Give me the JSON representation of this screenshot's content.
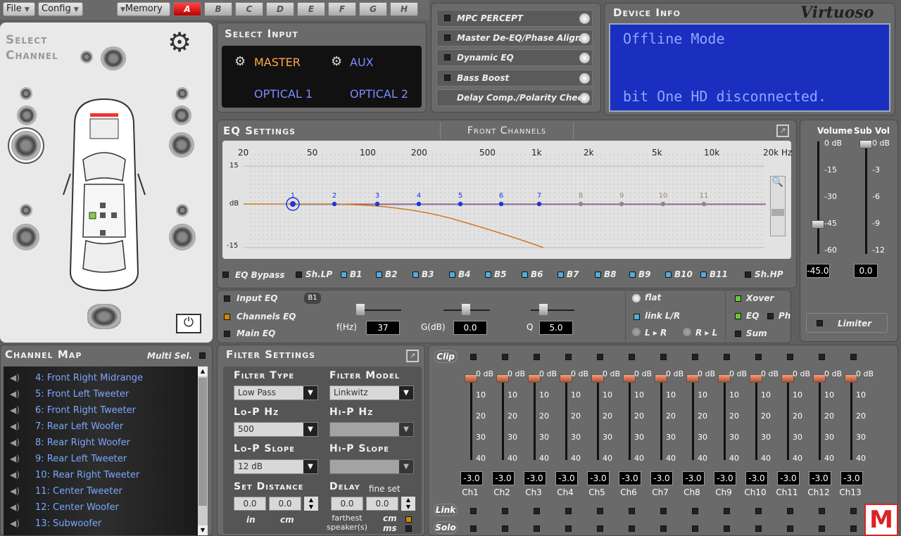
{
  "menu": {
    "file": "File",
    "config": "Config",
    "memory": "Memory"
  },
  "memory_tabs": [
    "A",
    "B",
    "C",
    "D",
    "E",
    "F",
    "G",
    "H"
  ],
  "select_channel": {
    "title_line1": "Select",
    "title_line2": "Channel"
  },
  "select_input": {
    "title": "Select Input",
    "master": "MASTER",
    "aux": "AUX",
    "optical1": "OPTICAL 1",
    "optical2": "OPTICAL 2"
  },
  "options": [
    "MPC PERCEPT",
    "Master De-EQ/Phase Align.",
    "Dynamic EQ",
    "Bass Boost",
    "Delay Comp./Polarity Check"
  ],
  "device_info": {
    "title": "Device Info",
    "brand": "Virtuoso",
    "line1": "Offline Mode",
    "line2": "bit One HD disconnected."
  },
  "eq": {
    "title": "EQ Settings",
    "channel": "Front Channels",
    "freq_labels": [
      "20",
      "50",
      "100",
      "200",
      "500",
      "1k",
      "2k",
      "5k",
      "10k",
      "20k Hz"
    ],
    "db_labels": [
      "15",
      "dB",
      "-15"
    ],
    "points": [
      "1",
      "2",
      "3",
      "4",
      "5",
      "6",
      "7",
      "8",
      "9",
      "10",
      "11"
    ],
    "bypass": "EQ Bypass",
    "shlp": "Sh.LP",
    "shhp": "Sh.HP",
    "bands": [
      "B1",
      "B2",
      "B3",
      "B4",
      "B5",
      "B6",
      "B7",
      "B8",
      "B9",
      "B10",
      "B11"
    ]
  },
  "volume": {
    "vol_label": "Volume",
    "sub_label": "Sub Vol",
    "vol_scale": [
      "0 dB",
      "-15",
      "-30",
      "-45",
      "-60"
    ],
    "sub_scale": [
      "0 dB",
      "-3",
      "-6",
      "-9",
      "-12"
    ],
    "vol_value": "-45.0",
    "sub_value": "0.0",
    "limiter": "Limiter"
  },
  "eq_mode": {
    "input_eq": "Input EQ",
    "channels_eq": "Channels EQ",
    "main_eq": "Main EQ"
  },
  "band_edit": {
    "band": "B1",
    "f_label": "f(Hz)",
    "f_value": "37",
    "g_label": "G(dB)",
    "g_value": "0.0",
    "q_label": "Q",
    "q_value": "5.0"
  },
  "link": {
    "flat": "flat",
    "link_lr": "link L/R",
    "l_r": "L ▸ R",
    "r_l": "R ▸ L"
  },
  "xover": {
    "xover": "Xover",
    "eq": "EQ",
    "ph": "Ph",
    "sum": "Sum"
  },
  "channel_map": {
    "title": "Channel Map",
    "multi": "Multi Sel.",
    "items": [
      "4: Front Right Midrange",
      "5: Front Left Tweeter",
      "6: Front Right Tweeter",
      "7: Rear Left Woofer",
      "8: Rear Right Woofer",
      "9: Rear Left Tweeter",
      "10: Rear Right Tweeter",
      "11: Center Tweeter",
      "12: Center Woofer",
      "13: Subwoofer"
    ]
  },
  "filter": {
    "title": "Filter Settings",
    "type_label": "Filter Type",
    "type_value": "Low Pass",
    "model_label": "Filter Model",
    "model_value": "Linkwitz",
    "lop_label": "Lo-P Hz",
    "lop_value": "500",
    "hip_label": "Hi-P Hz",
    "lops_label": "Lo-P Slope",
    "lops_value": "12 dB",
    "hips_label": "Hi-P Slope",
    "dist_label": "Set Distance",
    "dist_in": "0.0",
    "dist_cm": "0.0",
    "in": "in",
    "cm": "cm",
    "delay_label": "Delay",
    "fine": "fine set",
    "delay1": "0.0",
    "delay2": "0.0",
    "farthest": "farthest speaker(s)",
    "cm2": "cm",
    "ms": "ms"
  },
  "mixer": {
    "clip": "Clip",
    "link": "Link",
    "solo": "Solo",
    "scale": [
      "0 dB",
      "10",
      "20",
      "30",
      "40"
    ],
    "channels": [
      "Ch1",
      "Ch2",
      "Ch3",
      "Ch4",
      "Ch5",
      "Ch6",
      "Ch7",
      "Ch8",
      "Ch9",
      "Ch10",
      "Ch11",
      "Ch12",
      "Ch13"
    ],
    "values": [
      "-3.0",
      "-3.0",
      "-3.0",
      "-3.0",
      "-3.0",
      "-3.0",
      "-3.0",
      "-3.0",
      "-3.0",
      "-3.0",
      "-3.0",
      "-3.0",
      "-3.0"
    ]
  }
}
